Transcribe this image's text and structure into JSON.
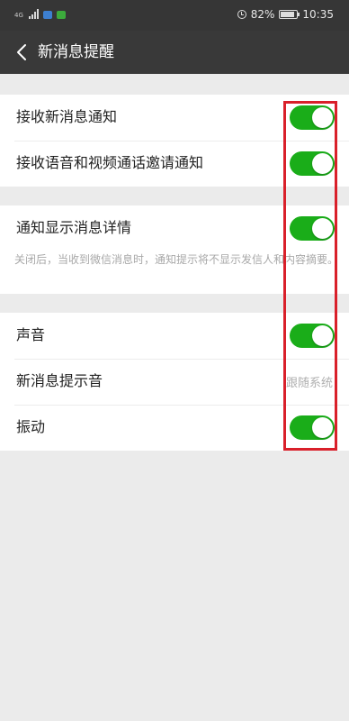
{
  "status_bar": {
    "network": "4G",
    "battery": "82%",
    "time": "10:35",
    "app_icon_colors": [
      "#3d7fd0",
      "#3caa3c"
    ]
  },
  "header": {
    "title": "新消息提醒",
    "back_icon": "chevron-left-icon"
  },
  "settings": {
    "receive_new_message": {
      "label": "接收新消息通知",
      "enabled": true
    },
    "receive_call_invites": {
      "label": "接收语音和视频通话邀请通知",
      "enabled": true
    },
    "show_details": {
      "label": "通知显示消息详情",
      "enabled": true,
      "description": "关闭后，当收到微信消息时，通知提示将不显示发信人和内容摘要。"
    },
    "sound": {
      "label": "声音",
      "enabled": true
    },
    "ringtone": {
      "label": "新消息提示音",
      "value": "跟随系统"
    },
    "vibrate": {
      "label": "振动",
      "enabled": true
    }
  },
  "colors": {
    "toggle_on": "#1aad19",
    "highlight_box": "#d9202a",
    "header_bg": "#393939"
  }
}
